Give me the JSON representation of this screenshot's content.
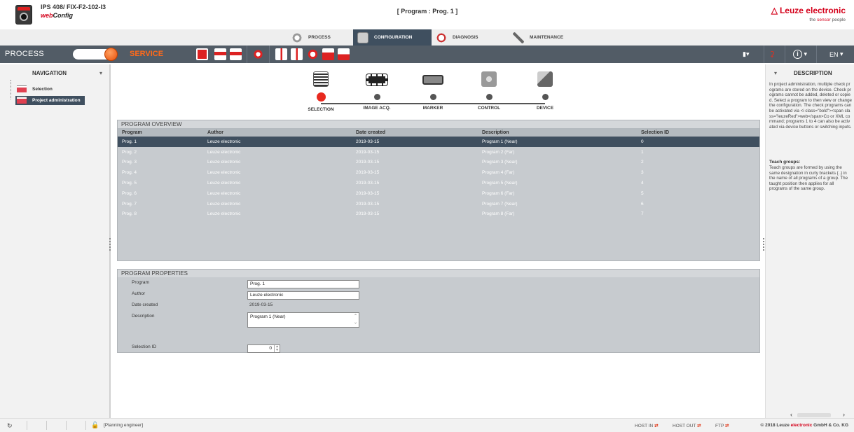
{
  "header": {
    "device_name": "IPS 408/ FIX-F2-102-I3",
    "app_name_prefix": "web",
    "app_name_suffix": "Config",
    "program_title": "[ Program : Prog. 1 ]",
    "brand_name": "Leuze electronic",
    "tagline_pre": "the ",
    "tagline_em": "sensor",
    "tagline_post": " people",
    "accent_color": "#d4001a"
  },
  "main_tabs": [
    {
      "label": "PROCESS",
      "icon": "gear-eye-icon"
    },
    {
      "label": "CONFIGURATION",
      "icon": "configuration-icon",
      "active": true
    },
    {
      "label": "DIAGNOSIS",
      "icon": "diagnosis-icon"
    },
    {
      "label": "MAINTENANCE",
      "icon": "tools-icon"
    }
  ],
  "toolbar": {
    "process_label": "PROCESS",
    "service_label": "SERVICE",
    "language": "EN",
    "info_symbol": "i",
    "bar_color": "#525c66",
    "service_color": "#ff6a1a"
  },
  "navigation": {
    "title": "NAVIGATION",
    "items": [
      {
        "label": "Selection"
      },
      {
        "label": "Project administration",
        "selected": true
      }
    ]
  },
  "wizard_steps": [
    {
      "label": "SELECTION",
      "active": true
    },
    {
      "label": "IMAGE ACQ."
    },
    {
      "label": "MARKER"
    },
    {
      "label": "CONTROL"
    },
    {
      "label": "DEVICE"
    }
  ],
  "program_overview": {
    "title": "PROGRAM OVERVIEW",
    "columns": [
      "Program",
      "Author",
      "Date created",
      "Description",
      "Selection ID"
    ],
    "rows": [
      {
        "program": "Prog. 1",
        "author": "Leuze electronic",
        "date": "2019-03-15",
        "description": "Program 1 (Near)",
        "id": "0",
        "selected": true
      },
      {
        "program": "Prog. 2",
        "author": "Leuze electronic",
        "date": "2019-03-15",
        "description": "Program 2 (Far)",
        "id": "1"
      },
      {
        "program": "Prog. 3",
        "author": "Leuze electronic",
        "date": "2019-03-15",
        "description": "Program 3 (Near)",
        "id": "2"
      },
      {
        "program": "Prog. 4",
        "author": "Leuze electronic",
        "date": "2019-03-15",
        "description": "Program 4 (Far)",
        "id": "3"
      },
      {
        "program": "Prog. 5",
        "author": "Leuze electronic",
        "date": "2019-03-15",
        "description": "Program 5 (Near)",
        "id": "4"
      },
      {
        "program": "Prog. 6",
        "author": "Leuze electronic",
        "date": "2019-03-15",
        "description": "Program 6 (Far)",
        "id": "5"
      },
      {
        "program": "Prog. 7",
        "author": "Leuze electronic",
        "date": "2019-03-15",
        "description": "Program 7 (Near)",
        "id": "6"
      },
      {
        "program": "Prog. 8",
        "author": "Leuze electronic",
        "date": "2019-03-15",
        "description": "Program 8 (Far)",
        "id": "7"
      }
    ]
  },
  "program_properties": {
    "title": "PROGRAM PROPERTIES",
    "program_label": "Program",
    "program_value": "Prog. 1",
    "author_label": "Author",
    "author_value": "Leuze electronic",
    "date_label": "Date created",
    "date_value": "2019-03-15",
    "description_label": "Description",
    "description_value": "Program 1 (Near)",
    "selection_id_label": "Selection ID",
    "selection_id_value": "0"
  },
  "description_panel": {
    "title": "DESCRIPTION",
    "body": "In project administration, multiple check programs are stored on the device. Check programs cannot be added, deleted or copied. Select a program to then view or change the configuration. The check programs can be activated via <i class=\"bold\"><span class=\"leuzeRed\">web</span>Co or XML command; programs 1 to 4 can also be activated via device buttons or switching inputs.",
    "teach_title": "Teach groups:",
    "teach_body": "Teach groups are formed by using the same designation in curly brackets {..} in the name of all programs of a group. The taught position then applies for all programs of the same group."
  },
  "status_bar": {
    "user_role": "[Planning engineer]",
    "host_in": "HOST IN",
    "host_out": "HOST OUT",
    "ftp": "FTP",
    "copyright_pre": "© 2018 Leuze ",
    "copyright_em": "electronic",
    "copyright_post": " GmbH & Co. KG"
  }
}
